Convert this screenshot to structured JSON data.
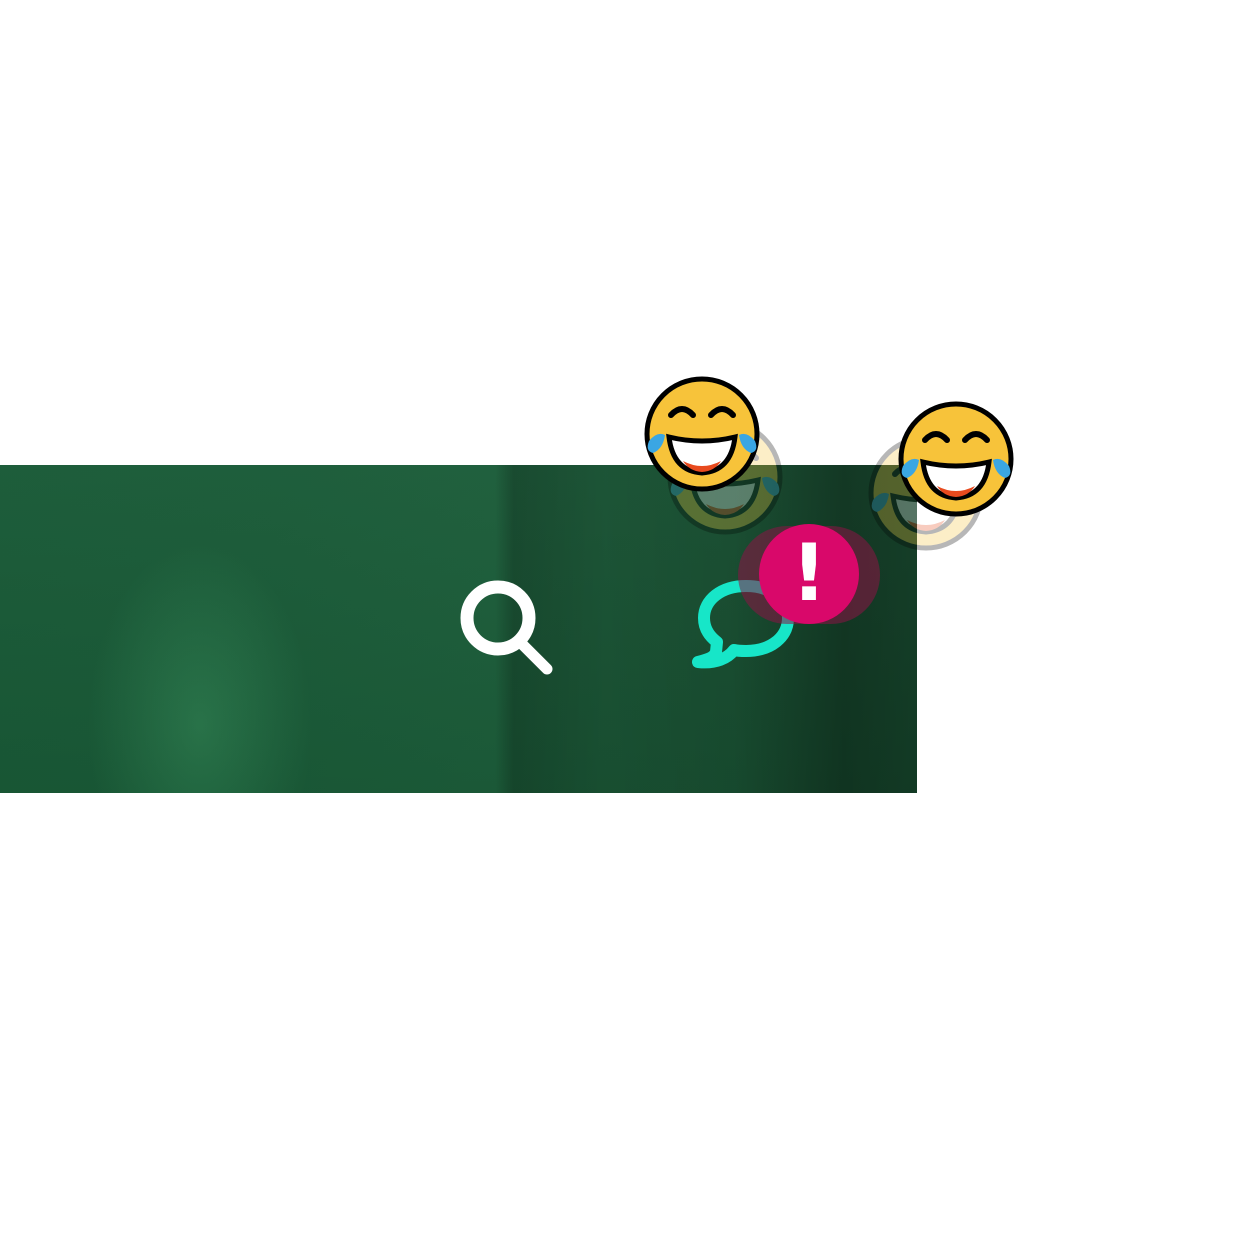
{
  "icons": {
    "search": "search-icon",
    "chat": "chat-bubble-icon",
    "alert": "exclamation-icon",
    "emoji": "face-with-tears-of-joy-icon"
  },
  "alert_badge": {
    "text": "!"
  },
  "colors": {
    "bar": "#1b5c39",
    "search_icon": "#ffffff",
    "chat_icon": "#17e6c8",
    "alert_badge": "#d9086a",
    "emoji_face": "#f7c33a",
    "emoji_tear": "#3aa6e3"
  }
}
